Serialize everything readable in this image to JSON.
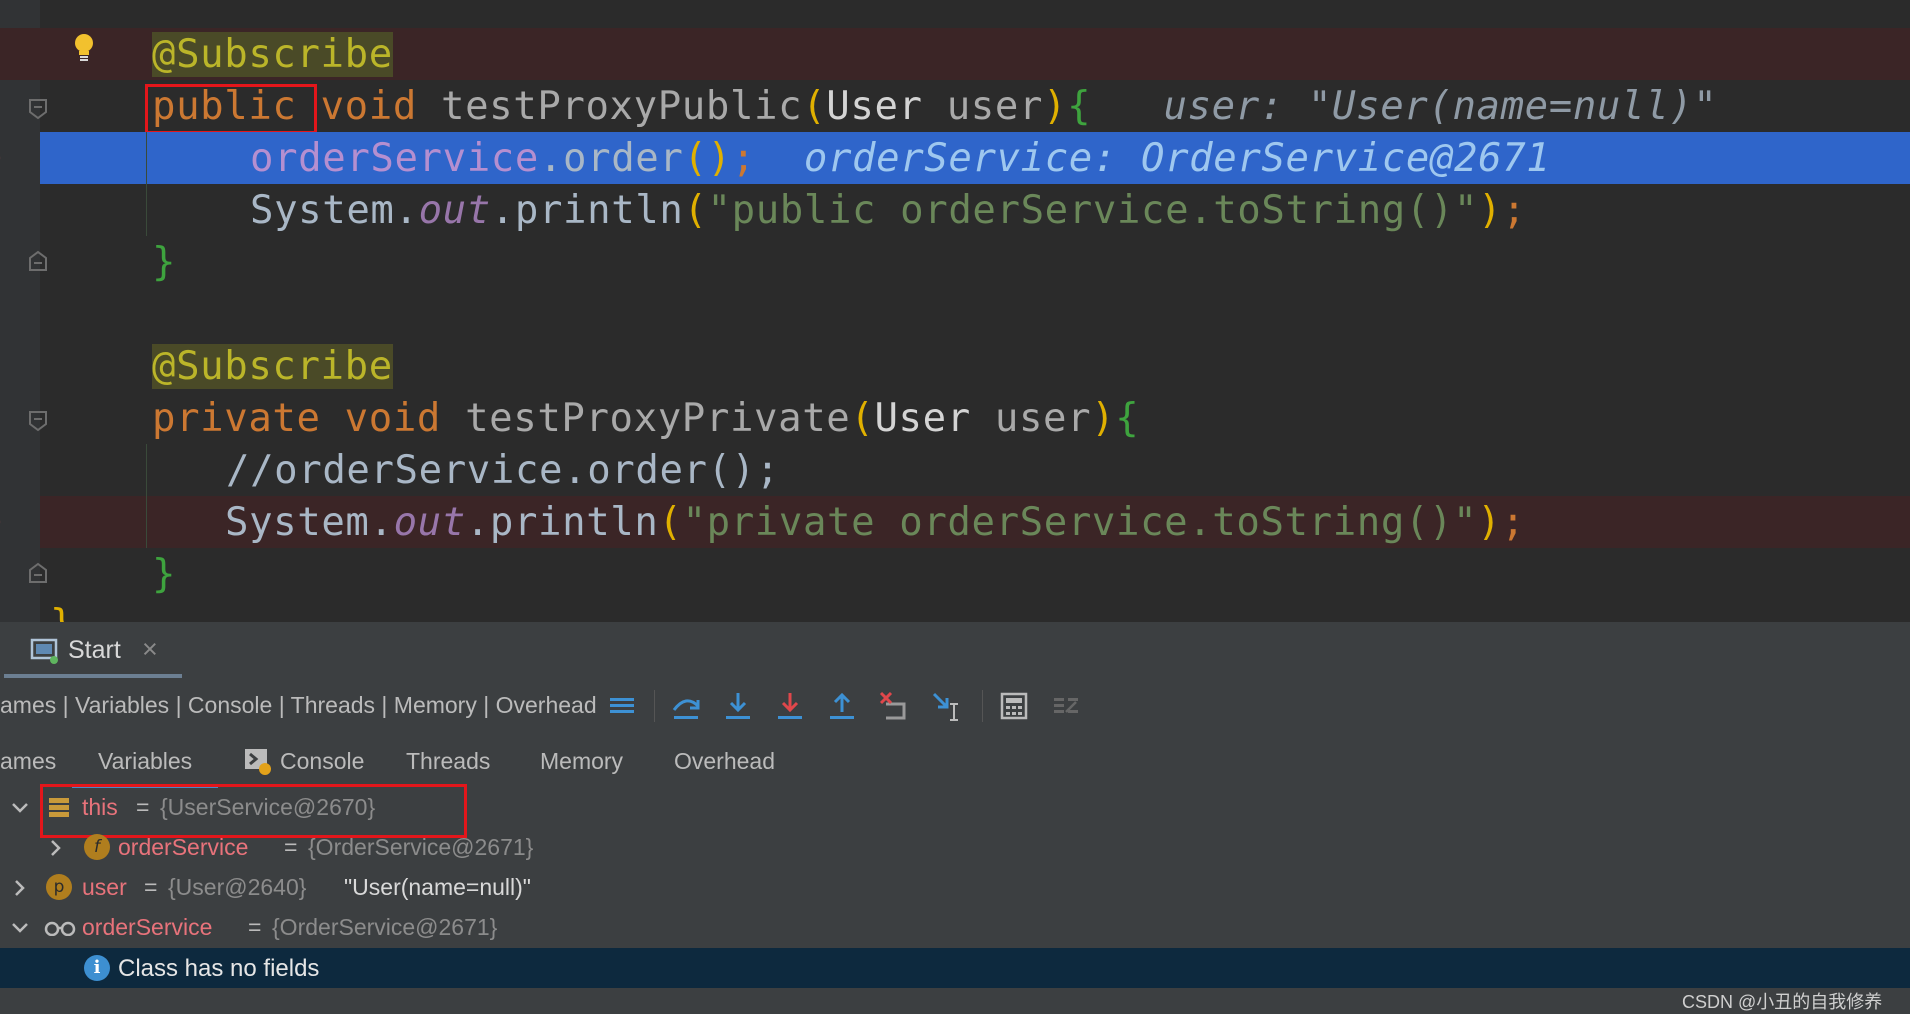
{
  "editor": {
    "lines": [
      {
        "annotation": "@Subscribe"
      },
      {
        "modifier": "public",
        "ret": "void",
        "method": "testProxyPublic",
        "param_type": "User",
        "param_name": "user",
        "hint": "user: \"User(name=null)\""
      },
      {
        "target": "orderService",
        "call": ".order",
        "args": "()",
        "semi": ";",
        "hint": "orderService: OrderService@2671"
      },
      {
        "obj": "System.",
        "field": "out",
        "call": ".println",
        "open": "(",
        "string": "\"public orderService.toString()\"",
        "close": ")",
        "semi": ";"
      },
      {
        "brace": "}"
      },
      {
        "annotation": "@Subscribe"
      },
      {
        "modifier": "private",
        "ret": "void",
        "method": "testProxyPrivate",
        "param_type": "User",
        "param_name": "user"
      },
      {
        "comment": "//orderService.order();"
      },
      {
        "obj": "System.",
        "field": "out",
        "call": ".println",
        "open": "(",
        "string": "\"private orderService.toString()\"",
        "close": ")",
        "semi": ";"
      },
      {
        "brace": "}"
      },
      {
        "brace": "}"
      }
    ]
  },
  "debug_panel": {
    "run_tab": "Start",
    "close_glyph": "×",
    "layout_label": "ames | Variables | Console | Threads | Memory | Overhead",
    "tabs": [
      "ames",
      "Variables",
      "Console",
      "Threads",
      "Memory",
      "Overhead"
    ],
    "variables": [
      {
        "name": "this",
        "eq": "=",
        "value": "{UserService@2670}",
        "icon": "stack-frame-icon",
        "expanded": true
      },
      {
        "name": "orderService",
        "eq": "=",
        "value": "{OrderService@2671}",
        "icon": "field-icon",
        "icon_letter": "f",
        "expanded": false
      },
      {
        "name": "user",
        "eq": "=",
        "value": "{User@2640}",
        "extra": "\"User(name=null)\"",
        "icon": "parameter-icon",
        "icon_letter": "p",
        "expanded": false
      },
      {
        "name": "orderService",
        "eq": "=",
        "value": "{OrderService@2671}",
        "icon": "watch-glasses-icon",
        "expanded": true
      }
    ],
    "info_row": {
      "text": "Class has no fields",
      "icon": "info-icon",
      "icon_letter": "i"
    }
  },
  "watermark": "CSDN @小丑的自我修养",
  "colors": {
    "editor_bg": "#2b2b2b",
    "execution_line": "#2f65ca",
    "breakpoint_line": "#3b2526",
    "annotation": "#bbb529",
    "keyword": "#cc7832",
    "string": "#6a8759",
    "highlight_box": "#e3161b",
    "panel_bg": "#3c3f41",
    "info_row_bg": "#0d293e"
  }
}
